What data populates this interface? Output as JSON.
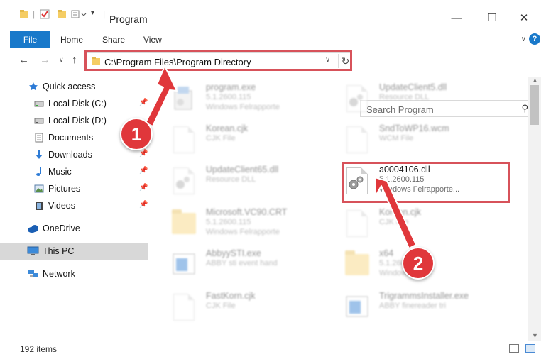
{
  "window": {
    "title": "Program",
    "minimize": "—",
    "maximize": "☐",
    "close": "✕"
  },
  "ribbon": {
    "file": "File",
    "tabs": [
      "Home",
      "Share",
      "View"
    ],
    "collapse": "∨",
    "help": "?"
  },
  "nav": {
    "back": "←",
    "forward": "→",
    "recent": "∨",
    "up": "↑"
  },
  "address": {
    "path": "C:\\Program Files\\Program Directory",
    "dropdown": "∨",
    "refresh": "↻"
  },
  "search": {
    "placeholder": "Search Program",
    "icon": "⚲"
  },
  "sidebar": {
    "quick_access": "Quick access",
    "items": [
      {
        "label": "Local Disk (C:)",
        "icon": "drive-icon",
        "pinned": true
      },
      {
        "label": "Local Disk (D:)",
        "icon": "drive-icon",
        "pinned": false
      },
      {
        "label": "Documents",
        "icon": "documents-icon",
        "pinned": true
      },
      {
        "label": "Downloads",
        "icon": "downloads-icon",
        "pinned": true
      },
      {
        "label": "Music",
        "icon": "music-icon",
        "pinned": true
      },
      {
        "label": "Pictures",
        "icon": "pictures-icon",
        "pinned": true
      },
      {
        "label": "Videos",
        "icon": "videos-icon",
        "pinned": true
      }
    ],
    "onedrive": "OneDrive",
    "this_pc": "This PC",
    "network": "Network",
    "pin_glyph": "📌"
  },
  "files": [
    {
      "name": "program.exe",
      "line1": "5.1.2600.115",
      "line2": "Windows Felrapporte",
      "icon": "exe-icon"
    },
    {
      "name": "UpdateClient5.dll",
      "line1": "Resource DLL",
      "line2": "",
      "icon": "dll-icon"
    },
    {
      "name": "Korean.cjk",
      "line1": "CJK File",
      "line2": "",
      "icon": "file-icon"
    },
    {
      "name": "SndToWP16.wcm",
      "line1": "WCM File",
      "line2": "",
      "icon": "file-icon"
    },
    {
      "name": "UpdateClient65.dll",
      "line1": "Resource DLL",
      "line2": "",
      "icon": "dll-icon"
    },
    {
      "name": "a0004106.dll",
      "line1": "5.1.2600.115",
      "line2": "Windows Felrapporte...",
      "icon": "dll-icon"
    },
    {
      "name": "Microsoft.VC90.CRT",
      "line1": "5.1.2600.115",
      "line2": "Windows Felrapporte",
      "icon": "folder-icon"
    },
    {
      "name": "Korean.cjk",
      "line1": "CJK File",
      "line2": "",
      "icon": "file-icon"
    },
    {
      "name": "AbbyySTI.exe",
      "line1": "ABBY sti event hand",
      "line2": "",
      "icon": "app-icon"
    },
    {
      "name": "x64",
      "line1": "5.1.2600",
      "line2": "Windows",
      "icon": "folder-icon"
    },
    {
      "name": "FastKorn.cjk",
      "line1": "CJK File",
      "line2": "",
      "icon": "file-icon"
    },
    {
      "name": "TrigrammsInstaller.exe",
      "line1": "ABBY finereader tri",
      "line2": "",
      "icon": "app-icon"
    }
  ],
  "status": {
    "count": "192 items"
  },
  "annotations": {
    "step1": "1",
    "step2": "2"
  },
  "colors": {
    "accent": "#1979ca",
    "highlight": "#d7525a",
    "badge": "#e0373b"
  }
}
